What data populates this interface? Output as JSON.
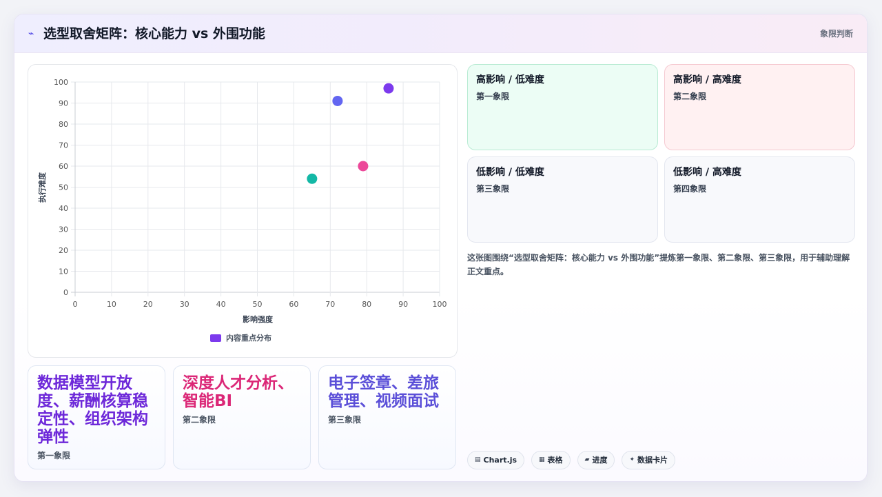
{
  "header": {
    "icon": "trend-line-icon",
    "title": "选型取舍矩阵：核心能力 vs 外围功能",
    "badge": "象限判断"
  },
  "colors": {
    "accent": "#4f46e5",
    "tile1": "#6d28d9",
    "tile2": "#db2777",
    "tile3": "#5b4fd8"
  },
  "chart_data": {
    "type": "scatter",
    "xlabel": "影响强度",
    "ylabel": "执行难度",
    "xlim": [
      0,
      100
    ],
    "ylim": [
      0,
      100
    ],
    "xticks": [
      0,
      10,
      20,
      30,
      40,
      50,
      60,
      70,
      80,
      90,
      100
    ],
    "yticks": [
      0,
      10,
      20,
      30,
      40,
      50,
      60,
      70,
      80,
      90,
      100
    ],
    "grid": true,
    "legend": "bottom",
    "series": [
      {
        "name": "内容重点分布",
        "legend_color": "#7c3aed",
        "points": [
          {
            "x": 72,
            "y": 91,
            "color": "#6366f1"
          },
          {
            "x": 86,
            "y": 97,
            "color": "#7c3aed"
          },
          {
            "x": 79,
            "y": 60,
            "color": "#ec4899"
          },
          {
            "x": 65,
            "y": 54,
            "color": "#14b8a6"
          }
        ]
      }
    ]
  },
  "quadrants": [
    {
      "title": "高影响 / 低难度",
      "label": "第一象限"
    },
    {
      "title": "高影响 / 高难度",
      "label": "第二象限"
    },
    {
      "title": "低影响 / 低难度",
      "label": "第三象限"
    },
    {
      "title": "低影响 / 高难度",
      "label": "第四象限"
    }
  ],
  "summary": "这张图围绕“选型取舍矩阵：核心能力 vs 外围功能”提炼第一象限、第二象限、第三象限，用于辅助理解正文重点。",
  "tiles": [
    {
      "main": "数据模型开放度、薪酬核算稳定性、组织架构弹性",
      "sub": "第一象限"
    },
    {
      "main": "深度人才分析、智能BI",
      "sub": "第二象限"
    },
    {
      "main": "电子签章、差旅管理、视频面试",
      "sub": "第三象限"
    }
  ],
  "chips": [
    {
      "icon": "chart-icon",
      "glyph": "▤",
      "label": "Chart.js"
    },
    {
      "icon": "table-icon",
      "glyph": "▦",
      "label": "表格"
    },
    {
      "icon": "progress-icon",
      "glyph": "▰",
      "label": "进度"
    },
    {
      "icon": "sparkle-icon",
      "glyph": "✦",
      "label": "数据卡片"
    }
  ]
}
